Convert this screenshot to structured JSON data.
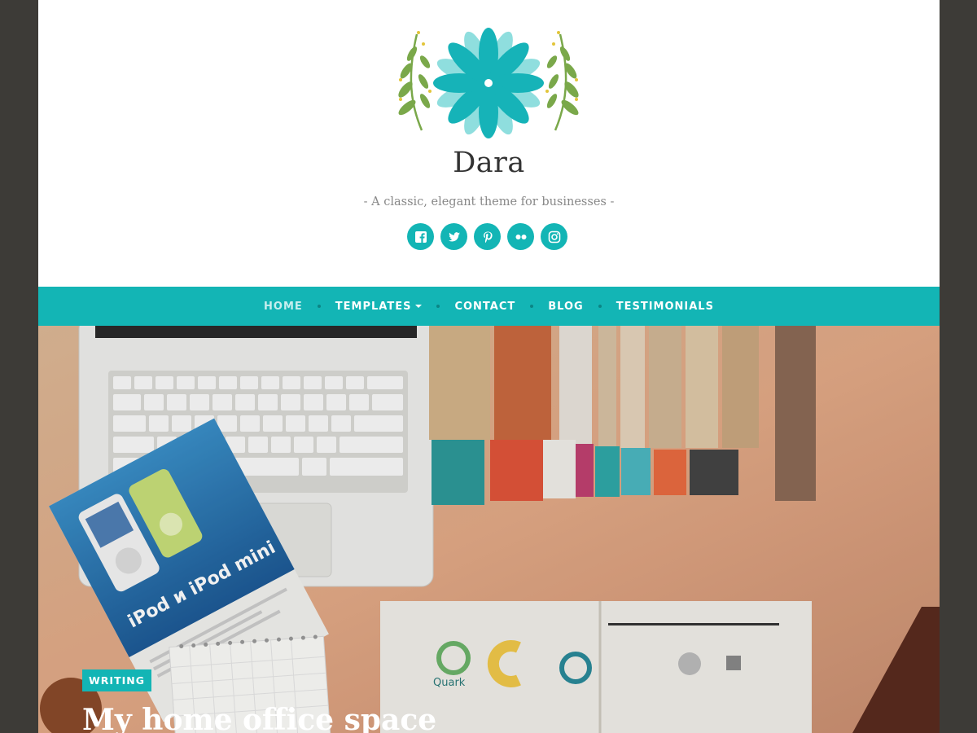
{
  "site": {
    "title": "Dara",
    "tagline": "- A classic, elegant theme for businesses -"
  },
  "social": [
    {
      "icon": "facebook-icon"
    },
    {
      "icon": "twitter-icon"
    },
    {
      "icon": "pinterest-icon"
    },
    {
      "icon": "flickr-icon"
    },
    {
      "icon": "instagram-icon"
    }
  ],
  "nav": {
    "items": [
      {
        "label": "HOME",
        "active": true
      },
      {
        "label": "TEMPLATES",
        "has_dropdown": true
      },
      {
        "label": "CONTACT"
      },
      {
        "label": "BLOG"
      },
      {
        "label": "TESTIMONIALS"
      }
    ]
  },
  "featured": {
    "category": "WRITING",
    "title": "My home office space",
    "image_text": {
      "brochure": "iPod и iPod mini",
      "logo_word": "Quark"
    }
  },
  "colors": {
    "accent": "#13b5b5",
    "outer_background": "#3d3b37",
    "nav_active": "#c7eeee"
  }
}
